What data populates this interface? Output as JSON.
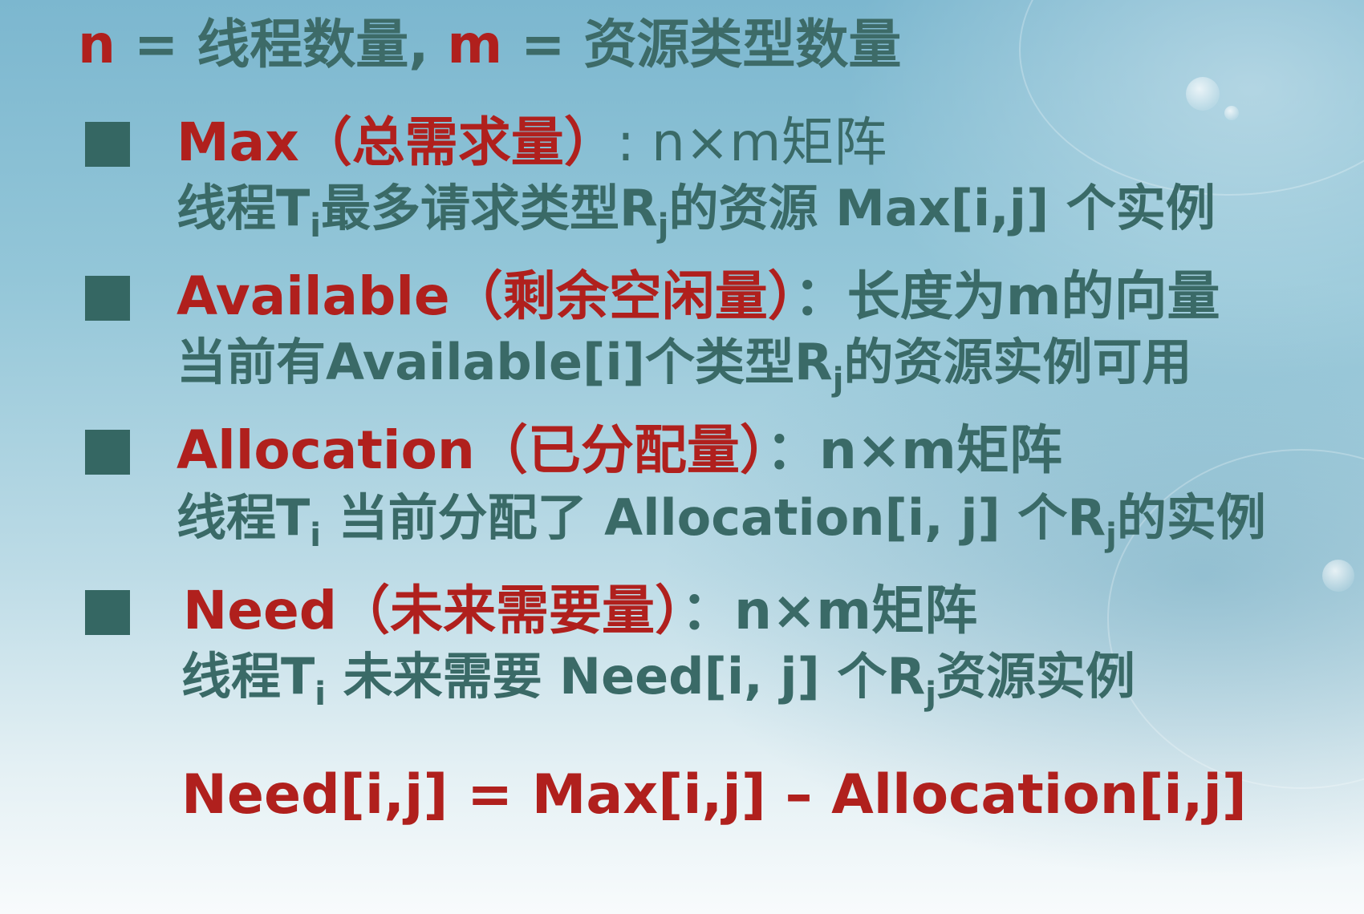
{
  "heading": {
    "n_var": "n",
    "eq1": " = ",
    "n_text": "线程数量,",
    "m_var": "m",
    "eq2": " = ",
    "m_text": "资源类型数量"
  },
  "bullets": [
    {
      "name_label": "Max",
      "paren_label": "（总需求量）",
      "type_text": ": n×m矩阵",
      "desc_prefix": "线程T",
      "desc_sub1": "i",
      "desc_mid": "最多请求类型R",
      "desc_sub2": "j",
      "desc_suffix": "的资源 Max[i,j] 个实例"
    },
    {
      "name_label": "Available",
      "paren_label": "（剩余空闲量）",
      "type_text": "：长度为m的向量",
      "desc_prefix": "当前有Available[i]个类型R",
      "desc_sub1": "j",
      "desc_suffix": "的资源实例可用"
    },
    {
      "name_label": "Allocation",
      "paren_label": "（已分配量）",
      "type_text": "：n×m矩阵",
      "desc_prefix": "线程T",
      "desc_sub1": "i",
      "desc_mid": " 当前分配了 Allocation[i, j] 个R",
      "desc_sub2": "j",
      "desc_suffix": "的实例"
    },
    {
      "name_label": "Need",
      "paren_label": "（未来需要量）",
      "type_text": "：n×m矩阵",
      "desc_prefix": "线程T",
      "desc_sub1": "i",
      "desc_mid": " 未来需要 Need[i, j] 个R",
      "desc_sub2": "j",
      "desc_suffix": "资源实例"
    }
  ],
  "formula": "Need[i,j] = Max[i,j] – Allocation[i,j]",
  "colors": {
    "accent_red": "#b0201d",
    "text_teal": "#3a6a67",
    "bullet_square": "#356763"
  }
}
